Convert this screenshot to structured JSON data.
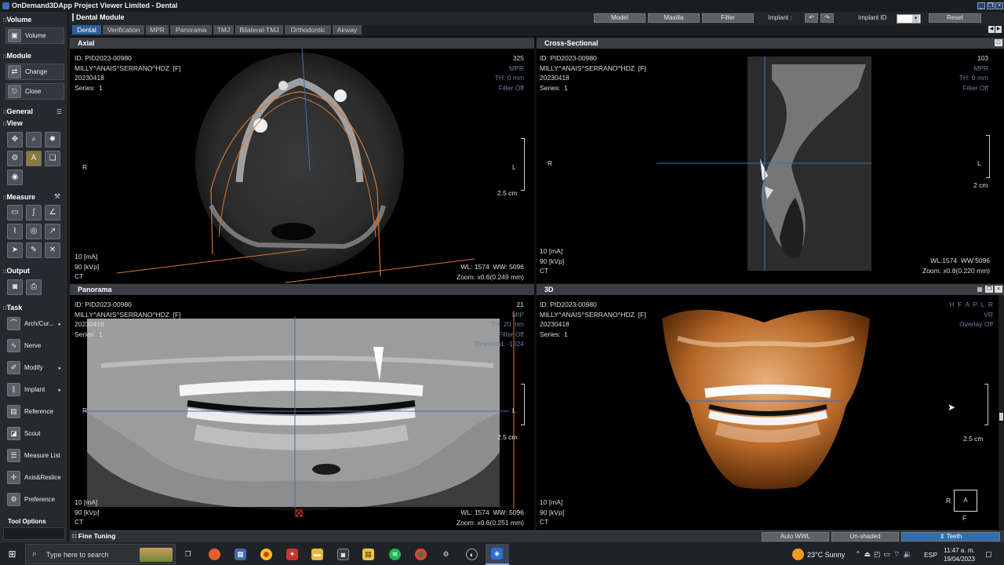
{
  "window": {
    "title": "OnDemand3DApp Project Viewer Limited - Dental"
  },
  "module_header": {
    "title": "Dental Module"
  },
  "toolbar": {
    "model_label": "Model",
    "maxilla_label": "Maxilla",
    "filter_label": "Filter",
    "implant_label": "Implant :",
    "implant_id_label": "Implant ID",
    "reset_label": "Reset"
  },
  "tabs": [
    {
      "label": "Dental"
    },
    {
      "label": "Verification"
    },
    {
      "label": "MPR"
    },
    {
      "label": "Panorama"
    },
    {
      "label": "TMJ"
    },
    {
      "label": "Bilateral-TMJ"
    },
    {
      "label": "Orthodontic"
    },
    {
      "label": "Airway"
    }
  ],
  "sidebar": {
    "volume": {
      "header": "Volume",
      "button": "Volume"
    },
    "module": {
      "header": "Module",
      "change": "Change",
      "close": "Close"
    },
    "general": {
      "header": "General",
      "view_header": "View"
    },
    "measure": {
      "header": "Measure"
    },
    "output": {
      "header": "Output"
    },
    "task": {
      "header": "Task",
      "items": [
        {
          "label": "Arch/Cur..."
        },
        {
          "label": "Nerve"
        },
        {
          "label": "Modify"
        },
        {
          "label": "Implant"
        },
        {
          "label": "Reference"
        },
        {
          "label": "Scout"
        },
        {
          "label": "Measure List"
        },
        {
          "label": "Axis&Reslice"
        },
        {
          "label": "Preference"
        }
      ]
    },
    "tool_options": "Tool Options"
  },
  "patient": {
    "id": "ID: PID2023-00980",
    "name": "MILLY^ANAIS^SERRANO^HDZ  [F]",
    "date": "20230418",
    "series": "Series:  1"
  },
  "viewports": {
    "axial": {
      "title": "Axial",
      "slice": "325",
      "mode": "MPR",
      "th": "TH: 0 mm",
      "filter": "Filter Off",
      "side_r": "R",
      "side_l": "L",
      "scale": "2.5 cm",
      "ma": "10 [mA]",
      "kvp": "90 [kVp]",
      "ct": "CT",
      "wl": "WL: 1574  WW: 5096",
      "zoom": "Zoom: x0.6(0.249 mm)"
    },
    "cross": {
      "title": "Cross-Sectional",
      "slice": "103",
      "mode": "MPR",
      "th": "TH: 0 mm",
      "filter": "Filter Off",
      "side_r": "R",
      "side_l": "L",
      "scale": "2 cm",
      "ma": "10 [mA]",
      "kvp": "90 [kVp]",
      "ct": "CT",
      "wl": "WL:1574  WW:5096",
      "zoom": "Zoom: x0.8(0.220 mm)"
    },
    "panorama": {
      "title": "Panorama",
      "slice": "21",
      "mode": "MIP",
      "th": "TH: 20 mm",
      "filter": "Filter Off",
      "threshold": "Threshold: -1024",
      "side_r": "R",
      "side_l": "L",
      "scale": "2.5 cm",
      "ma": "10 [mA]",
      "kvp": "90 [kVp]",
      "ct": "CT",
      "wl": "WL: 1574  WW: 5096",
      "zoom": "Zoom: x0.6(0.251 mm)"
    },
    "three_d": {
      "title": "3D",
      "orient": "H  F  A  P  L  R",
      "mode": "VR",
      "overlay": "Overlay Off",
      "scale": "2.5 cm",
      "ma": "10 [mA]",
      "kvp": "90 [kVp]",
      "ct": "CT",
      "cube_r": "R",
      "cube_a": "A",
      "cube_f": "F"
    }
  },
  "fine_tuning": {
    "label": "Fine Tuning",
    "auto_wwl": "Auto WWL",
    "unshaded": "Un-shaded",
    "teeth": "Teeth"
  },
  "taskbar": {
    "search_placeholder": "Type here to search",
    "weather": "23°C  Sunny",
    "lang": "ESP",
    "time": "11:47 a. m.",
    "date": "19/04/2023"
  },
  "colors": {
    "accent": "#2f5f98",
    "crosshair": "#3d6fb6",
    "arch_line": "#d9742b",
    "marker": "#e03030"
  }
}
